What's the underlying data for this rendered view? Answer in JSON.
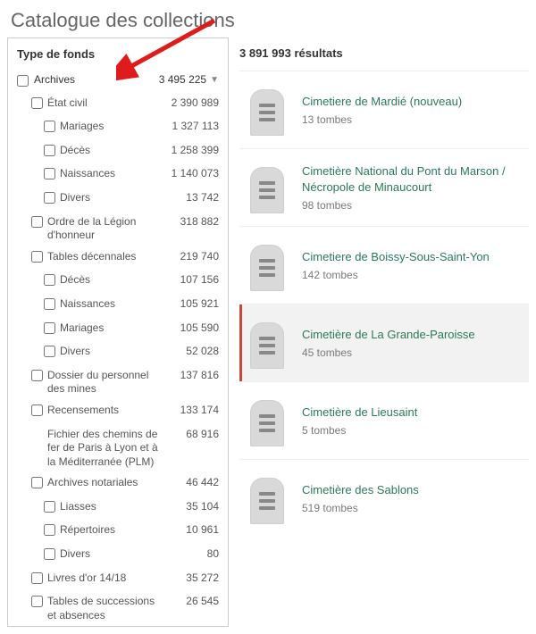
{
  "page_title": "Catalogue des collections",
  "sidebar": {
    "title": "Type de fonds",
    "top": {
      "label": "Archives",
      "count": "3 495 225"
    },
    "rows": [
      {
        "indent": 1,
        "label": "État civil",
        "count": "2 390 989"
      },
      {
        "indent": 2,
        "label": "Mariages",
        "count": "1 327 113"
      },
      {
        "indent": 2,
        "label": "Décès",
        "count": "1 258 399"
      },
      {
        "indent": 2,
        "label": "Naissances",
        "count": "1 140 073"
      },
      {
        "indent": 2,
        "label": "Divers",
        "count": "13 742"
      },
      {
        "indent": 1,
        "label": "Ordre de la Légion d'honneur",
        "count": "318 882"
      },
      {
        "indent": 1,
        "label": "Tables décennales",
        "count": "219 740"
      },
      {
        "indent": 2,
        "label": "Décès",
        "count": "107 156"
      },
      {
        "indent": 2,
        "label": "Naissances",
        "count": "105 921"
      },
      {
        "indent": 2,
        "label": "Mariages",
        "count": "105 590"
      },
      {
        "indent": 2,
        "label": "Divers",
        "count": "52 028"
      },
      {
        "indent": 1,
        "label": "Dossier du personnel des mines",
        "count": "137 816"
      },
      {
        "indent": 1,
        "label": "Recensements",
        "count": "133 174"
      },
      {
        "indent": 1,
        "label": "Fichier des chemins de fer de Paris à Lyon et à la Méditerranée (PLM)",
        "count": "68 916",
        "nocheck": true
      },
      {
        "indent": 1,
        "label": "Archives notariales",
        "count": "46 442"
      },
      {
        "indent": 2,
        "label": "Liasses",
        "count": "35 104"
      },
      {
        "indent": 2,
        "label": "Répertoires",
        "count": "10 961"
      },
      {
        "indent": 2,
        "label": "Divers",
        "count": "80"
      },
      {
        "indent": 1,
        "label": "Livres d'or 14/18",
        "count": "35 272"
      },
      {
        "indent": 1,
        "label": "Tables de successions et absences",
        "count": "26 545"
      }
    ]
  },
  "results": {
    "header": "3 891 993 résultats",
    "items": [
      {
        "title": "Cimetiere de Mardié (nouveau)",
        "sub": "13 tombes",
        "highlighted": false
      },
      {
        "title": "Cimetière National du Pont du Marson / Nécropole de Minaucourt",
        "sub": "98 tombes",
        "highlighted": false
      },
      {
        "title": "Cimetiere de Boissy-Sous-Saint-Yon",
        "sub": "142 tombes",
        "highlighted": false
      },
      {
        "title": "Cimetière de La Grande-Paroisse",
        "sub": "45 tombes",
        "highlighted": true
      },
      {
        "title": "Cimetière de Lieusaint",
        "sub": "5 tombes",
        "highlighted": false
      },
      {
        "title": "Cimetière des Sablons",
        "sub": "519 tombes",
        "highlighted": false
      }
    ]
  }
}
